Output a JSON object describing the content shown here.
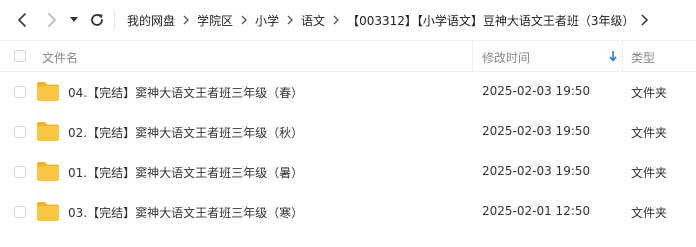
{
  "toolbar": {
    "back_icon": "chevron-left-icon",
    "forward_icon": "chevron-right-icon",
    "dropdown_icon": "caret-down-icon",
    "refresh_icon": "refresh-icon"
  },
  "breadcrumb": [
    "我的网盘",
    "学院区",
    "小学",
    "语文",
    "【003312】【小学语文】豆神大语文王者班（3年级）"
  ],
  "table": {
    "headers": {
      "name": "文件名",
      "modified": "修改时间",
      "type": "类型"
    },
    "sort_icon": "arrow-down-icon",
    "rows": [
      {
        "name": "04.【完结】窦神大语文王者班三年级（春）",
        "modified": "2025-02-03 19:50",
        "type": "文件夹"
      },
      {
        "name": "02.【完结】窦神大语文王者班三年级（秋）",
        "modified": "2025-02-03 19:50",
        "type": "文件夹"
      },
      {
        "name": "01.【完结】窦神大语文王者班三年级（暑）",
        "modified": "2025-02-03 19:50",
        "type": "文件夹"
      },
      {
        "name": "03.【完结】窦神大语文王者班三年级（寒）",
        "modified": "2025-02-01 12:50",
        "type": "文件夹"
      }
    ]
  },
  "colors": {
    "folder": "#f9c641",
    "folder_tab": "#f3b323",
    "accent": "#1a73e8",
    "text": "#333333",
    "muted": "#888888"
  }
}
